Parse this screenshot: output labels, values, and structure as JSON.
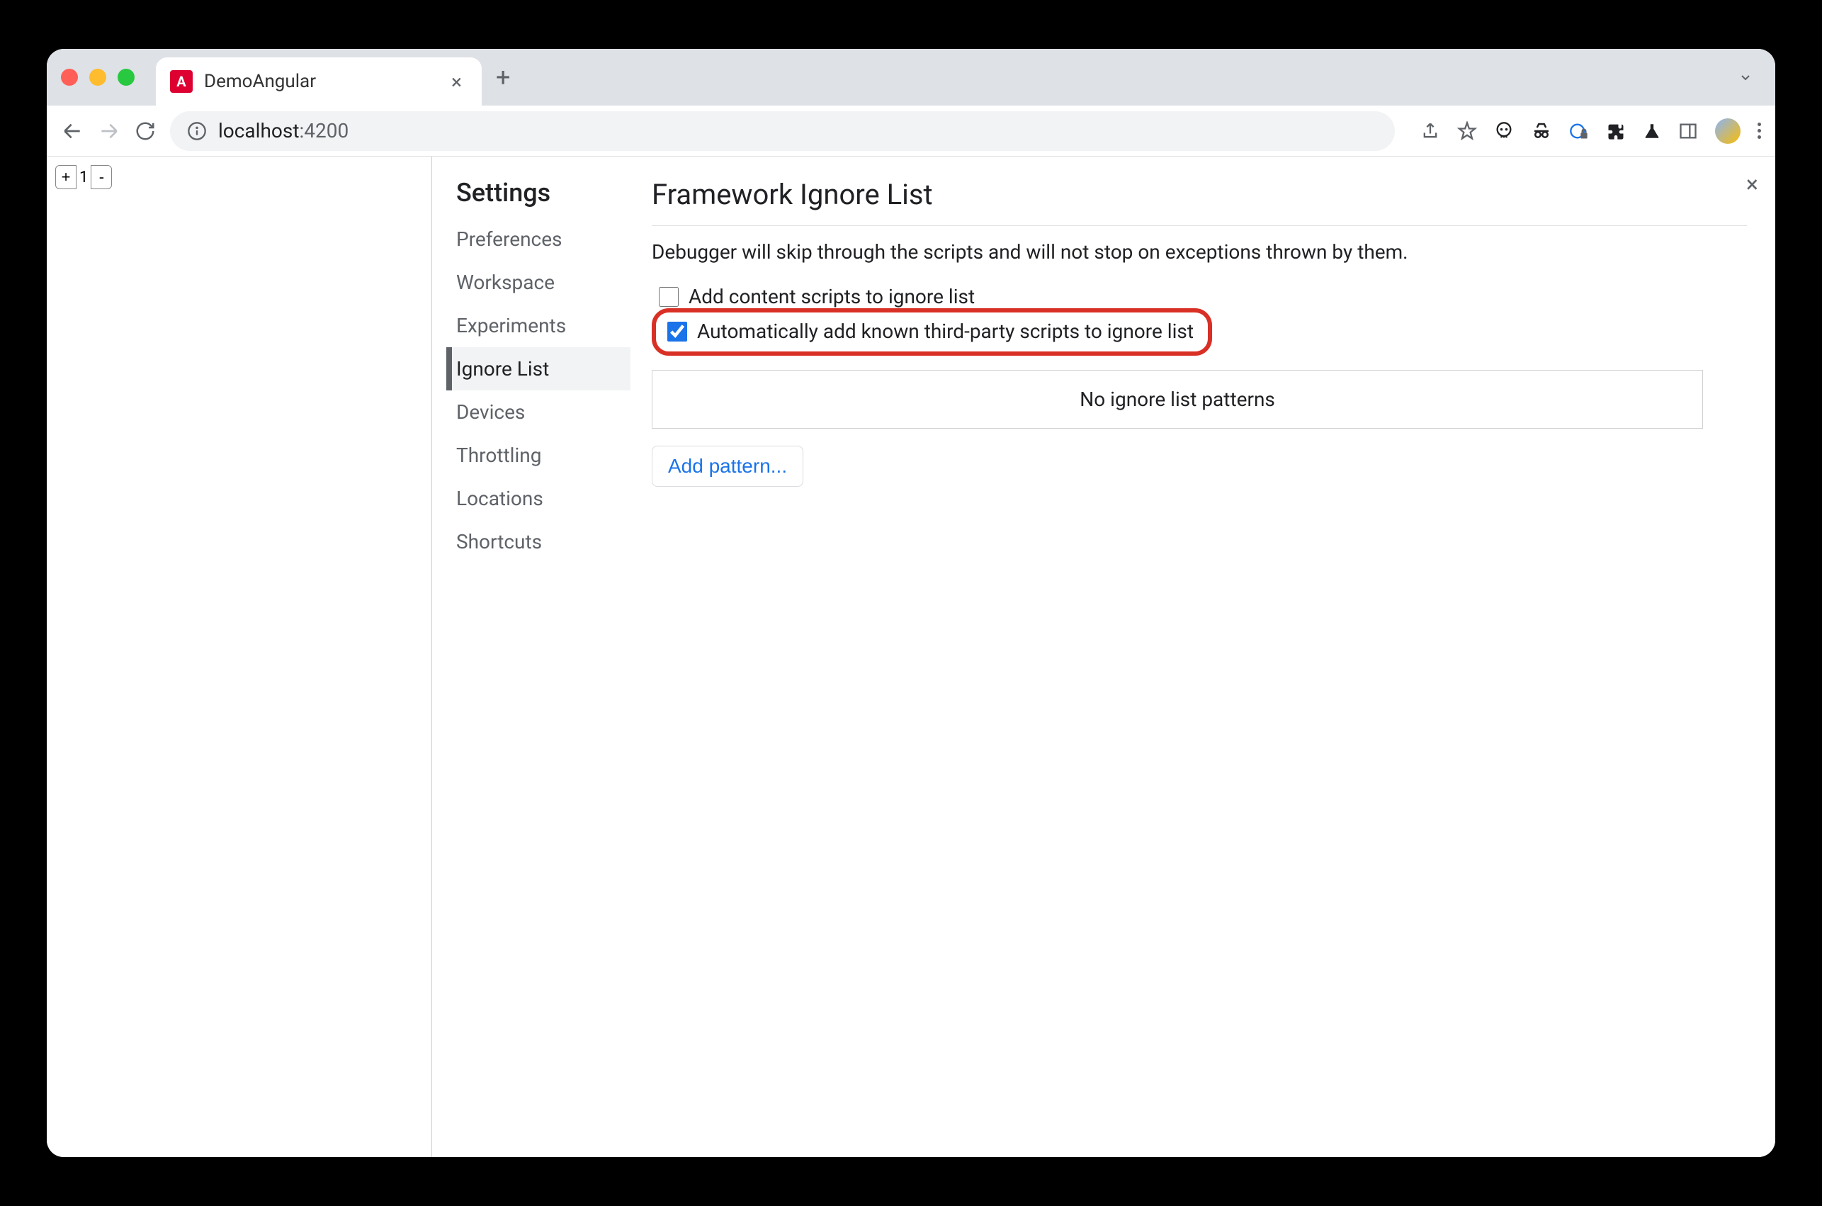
{
  "tab": {
    "title": "DemoAngular",
    "favicon_letter": "A"
  },
  "address": {
    "host": "localhost",
    "port": ":4200"
  },
  "page": {
    "counter_value": "1",
    "plus": "+",
    "minus": "-"
  },
  "settings": {
    "title": "Settings",
    "nav": [
      "Preferences",
      "Workspace",
      "Experiments",
      "Ignore List",
      "Devices",
      "Throttling",
      "Locations",
      "Shortcuts"
    ],
    "active_index": 3
  },
  "panel": {
    "title": "Framework Ignore List",
    "description": "Debugger will skip through the scripts and will not stop on exceptions thrown by them.",
    "checkbox1": {
      "label": "Add content scripts to ignore list",
      "checked": false
    },
    "checkbox2": {
      "label": "Automatically add known third-party scripts to ignore list",
      "checked": true
    },
    "empty_patterns": "No ignore list patterns",
    "add_pattern": "Add pattern..."
  }
}
